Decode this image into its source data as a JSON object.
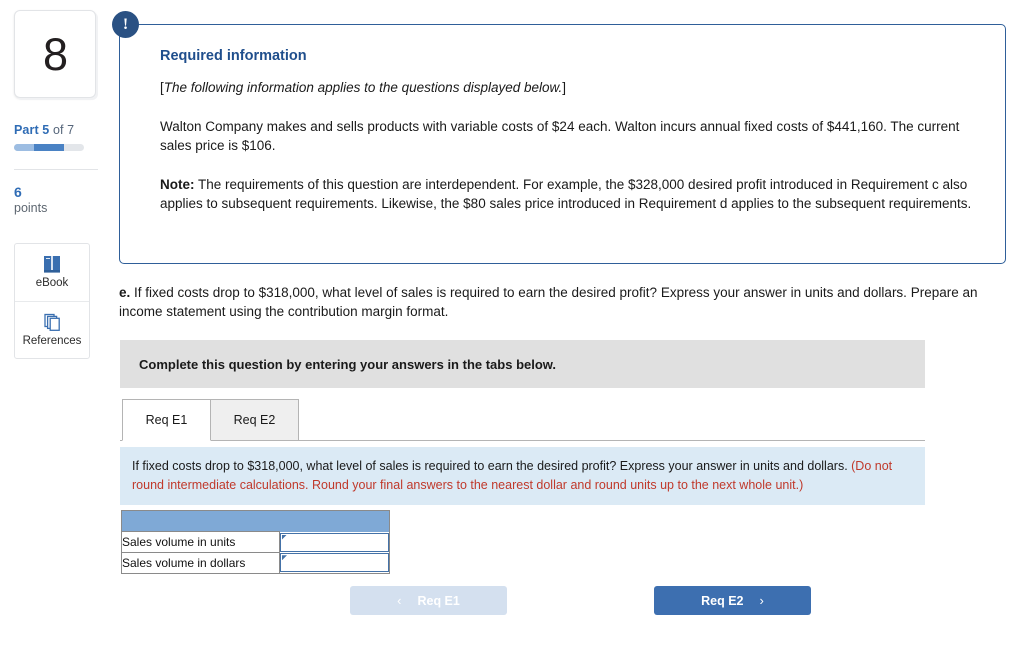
{
  "sidebar": {
    "question_number": "8",
    "part_prefix": "Part",
    "part_current": "5",
    "part_of": "of 7",
    "progress_percent": 71,
    "points_value": "6",
    "points_label": "points",
    "tools": [
      {
        "icon": "book-icon",
        "label": "eBook"
      },
      {
        "icon": "pages-icon",
        "label": "References"
      }
    ]
  },
  "required_panel": {
    "badge": "!",
    "heading": "Required information",
    "bracket_open": "[",
    "italic_note": "The following information applies to the questions displayed below.",
    "bracket_close": "]",
    "paragraph": "Walton Company makes and sells products with variable costs of $24 each. Walton incurs annual fixed costs of $441,160. The current sales price is $106.",
    "note_label": "Note:",
    "note_text": " The requirements of this question are interdependent. For example, the $328,000 desired profit introduced in Requirement c also applies to subsequent requirements. Likewise, the $80 sales price introduced in Requirement d applies to the subsequent requirements."
  },
  "question": {
    "letter": "e.",
    "text": " If fixed costs drop to $318,000, what level of sales is required to earn the desired profit? Express your answer in units and dollars. Prepare an income statement using the contribution margin format."
  },
  "instruction_bar": {
    "text": "Complete this question by entering your answers in the tabs below."
  },
  "tabs": [
    {
      "label": "Req E1",
      "active": true
    },
    {
      "label": "Req E2",
      "active": false
    }
  ],
  "blue_instruction": {
    "main": "If fixed costs drop to $318,000, what level of sales is required to earn the desired profit? Express your answer in units and dollars. ",
    "warning": "(Do not round intermediate calculations. Round your final answers to the nearest dollar and round units up to the next whole unit.)"
  },
  "answer_table": {
    "header_label": "",
    "rows": [
      {
        "label": "Sales volume in units",
        "value": ""
      },
      {
        "label": "Sales volume in dollars",
        "value": ""
      }
    ]
  },
  "nav": {
    "prev_label": "Req E1",
    "prev_chevron": "‹",
    "next_label": "Req E2",
    "next_chevron": "›"
  },
  "colors": {
    "accent_blue": "#3d6fb0",
    "panel_border": "#2f5f99",
    "badge_navy": "#2a5183",
    "heading_navy": "#1f4e8c",
    "table_header": "#7fa9d6",
    "instruction_blue_bg": "#dbeaf5",
    "warning_red": "#c0392b",
    "grey_bar": "#e0e0e0"
  }
}
